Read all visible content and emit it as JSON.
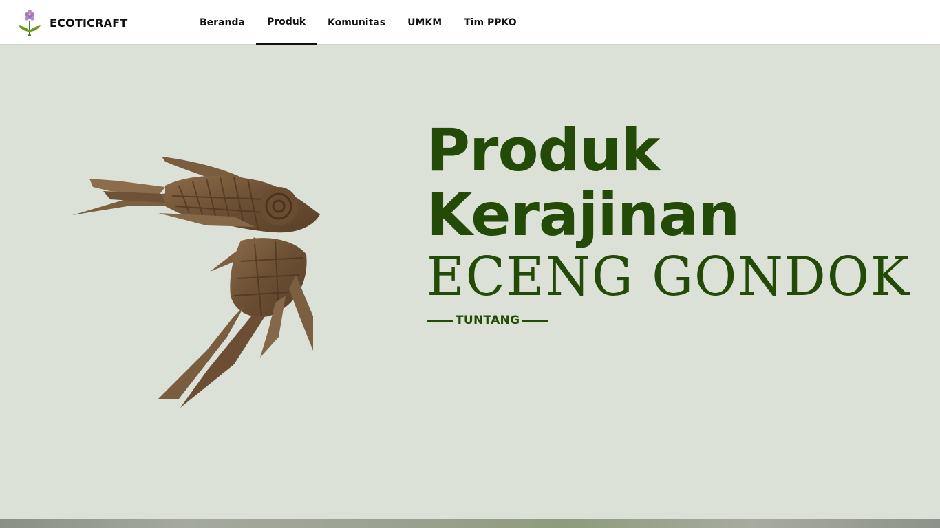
{
  "navbar": {
    "brand_name": "ECOTICRAFT",
    "brand_logo_icon": "water-hyacinth-flower-icon",
    "links": [
      {
        "label": "Beranda",
        "active": false
      },
      {
        "label": "Produk",
        "active": true
      },
      {
        "label": "Komunitas",
        "active": false
      },
      {
        "label": "UMKM",
        "active": false
      },
      {
        "label": "Tim PPKO",
        "active": false
      }
    ]
  },
  "hero": {
    "title_line1": "Produk",
    "title_line2": "Kerajinan",
    "title_line3": "ECENG GONDOK",
    "tag": "TUNTANG",
    "image": "woven-water-hyacinth-bird-craft"
  },
  "colors": {
    "background": "#dce1d7",
    "accent_green": "#234a07",
    "navbar": "#ffffff"
  }
}
